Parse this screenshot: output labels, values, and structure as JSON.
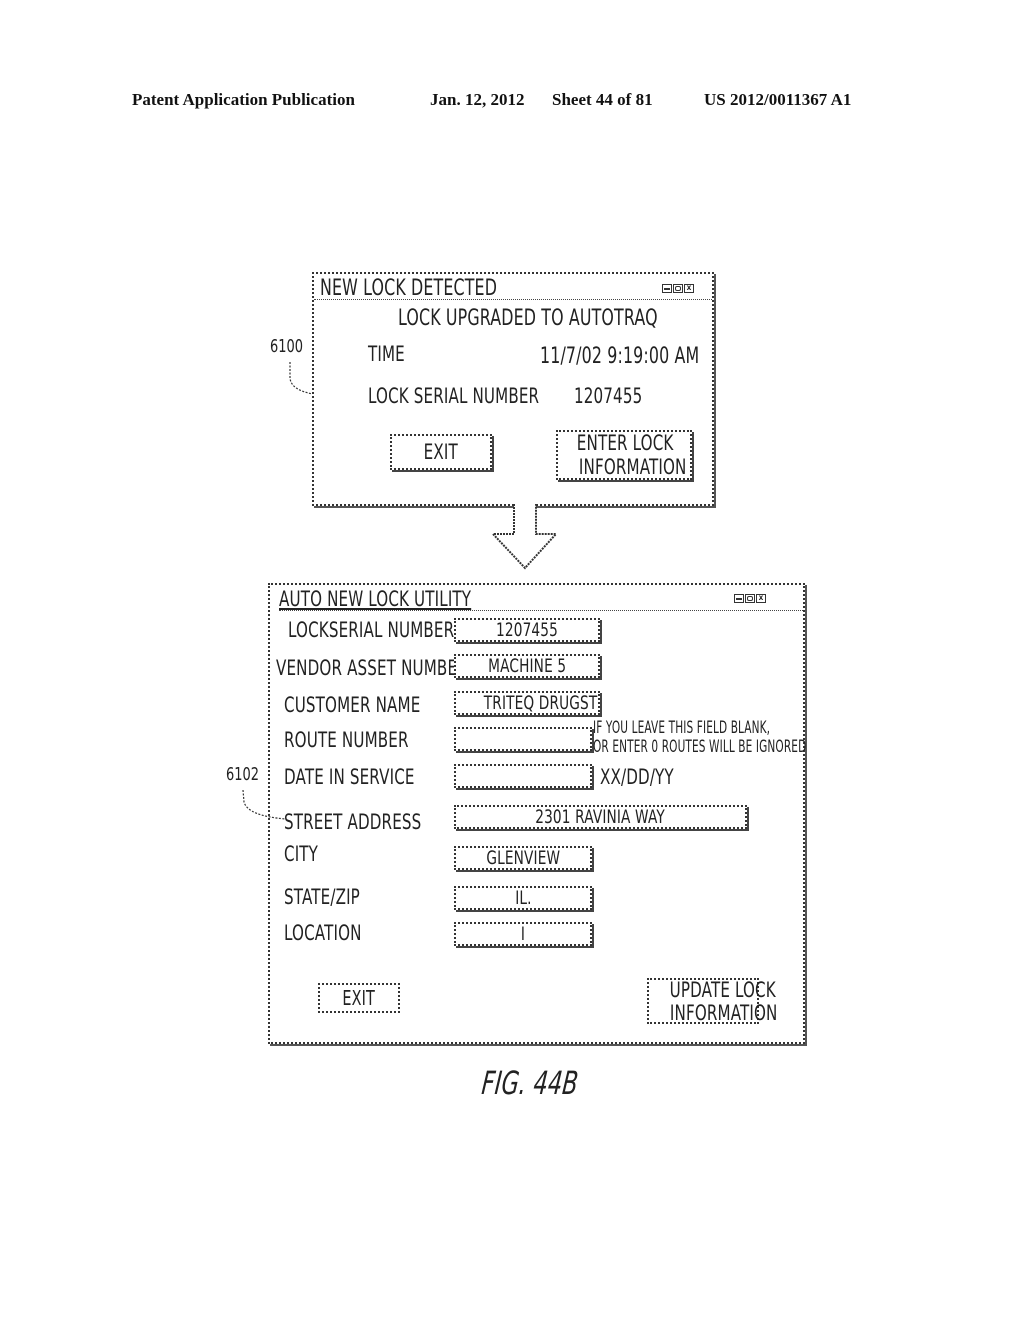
{
  "header": {
    "publication": "Patent Application Publication",
    "date": "Jan. 12, 2012",
    "sheet": "Sheet 44 of 81",
    "patent_number": "US 2012/0011367 A1"
  },
  "dialog_top": {
    "ref_label": "6100",
    "title": "NEW LOCK DETECTED",
    "controls": [
      "minimize-icon",
      "maximize-icon",
      "close-icon"
    ],
    "message": "LOCK UPGRADED TO AUTOTRAQ",
    "time_label": "TIME",
    "time_value": "11/7/02 9:19:00 AM",
    "serial_label": "LOCK SERIAL NUMBER",
    "serial_value": "1207455",
    "exit_label": "EXIT",
    "enter_label_line1": "ENTER LOCK",
    "enter_label_line2": "INFORMATION"
  },
  "arrow": {
    "icon": "down-arrow-icon"
  },
  "dialog_bottom": {
    "ref_label": "6102",
    "title": "AUTO NEW LOCK UTILITY",
    "controls": [
      "minimize-icon",
      "maximize-icon",
      "close-icon"
    ],
    "fields": [
      {
        "label": "LOCKSERIAL NUMBER",
        "value": "1207455"
      },
      {
        "label": "VENDOR ASSET NUMBER",
        "value": "MACHINE 5"
      },
      {
        "label": "CUSTOMER NAME",
        "value": "TRITEQ DRUGSTORE"
      },
      {
        "label": "ROUTE NUMBER",
        "value": ""
      },
      {
        "label": "DATE IN SERVICE",
        "value": ""
      },
      {
        "label": "STREET ADDRESS",
        "value": "2301 RAVINIA WAY"
      },
      {
        "label": "CITY",
        "value": "GLENVIEW"
      },
      {
        "label": "STATE/ZIP",
        "value": "IL."
      },
      {
        "label": "LOCATION",
        "value": "I"
      }
    ],
    "route_note_line1": "IF YOU LEAVE THIS FIELD BLANK,",
    "route_note_line2": "OR ENTER 0 ROUTES WILL BE IGNORED",
    "date_format_hint": "XX/DD/YY",
    "exit_label": "EXIT",
    "update_label_line1": "UPDATE LOCK",
    "update_label_line2": "INFORMATION"
  },
  "figure_caption": "FIG. 44B"
}
